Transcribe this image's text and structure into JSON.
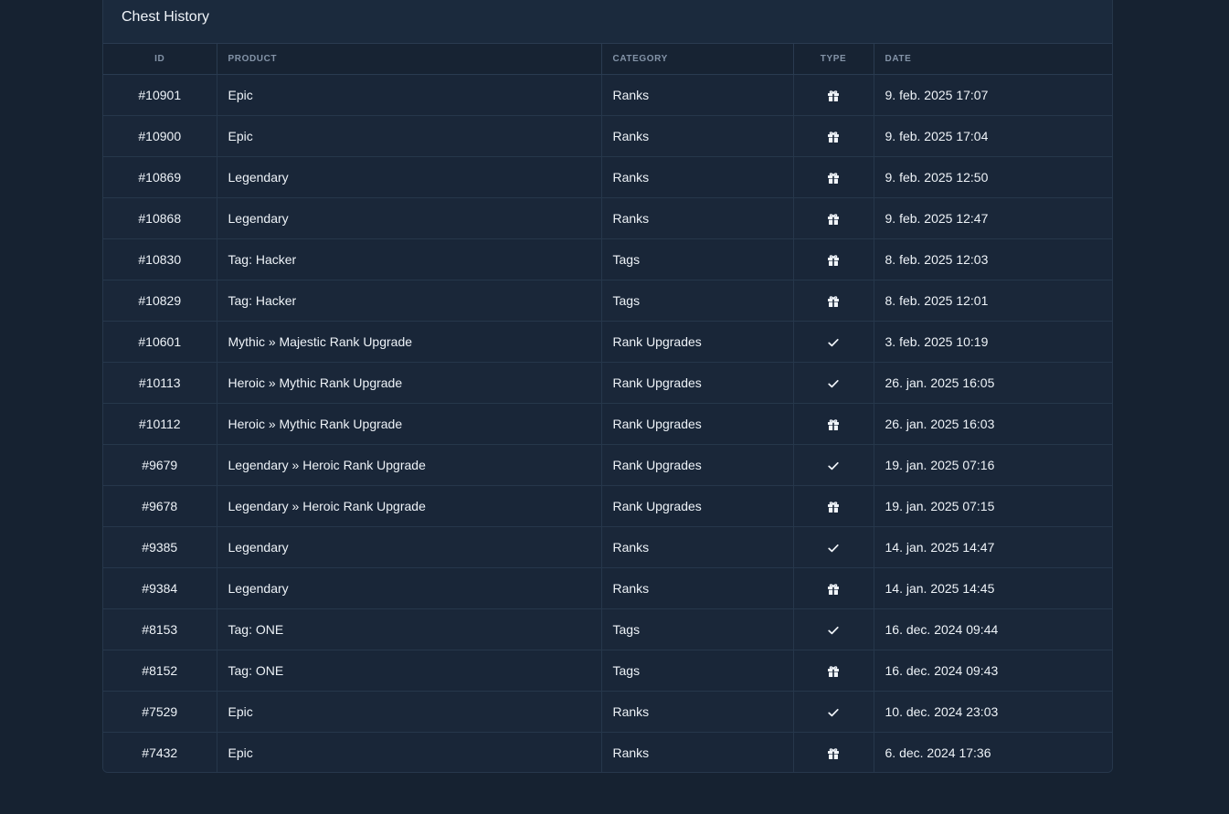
{
  "card": {
    "title": "Chest History"
  },
  "table": {
    "headers": {
      "id": "ID",
      "product": "PRODUCT",
      "category": "CATEGORY",
      "type": "TYPE",
      "date": "DATE"
    },
    "rows": [
      {
        "id": "#10901",
        "product": "Epic",
        "category": "Ranks",
        "type": "gift-icon",
        "date": "9. feb. 2025 17:07"
      },
      {
        "id": "#10900",
        "product": "Epic",
        "category": "Ranks",
        "type": "gift-icon",
        "date": "9. feb. 2025 17:04"
      },
      {
        "id": "#10869",
        "product": "Legendary",
        "category": "Ranks",
        "type": "gift-icon",
        "date": "9. feb. 2025 12:50"
      },
      {
        "id": "#10868",
        "product": "Legendary",
        "category": "Ranks",
        "type": "gift-icon",
        "date": "9. feb. 2025 12:47"
      },
      {
        "id": "#10830",
        "product": "Tag: Hacker",
        "category": "Tags",
        "type": "gift-icon",
        "date": "8. feb. 2025 12:03"
      },
      {
        "id": "#10829",
        "product": "Tag: Hacker",
        "category": "Tags",
        "type": "gift-icon",
        "date": "8. feb. 2025 12:01"
      },
      {
        "id": "#10601",
        "product": "Mythic » Majestic Rank Upgrade",
        "category": "Rank Upgrades",
        "type": "check-icon",
        "date": "3. feb. 2025 10:19"
      },
      {
        "id": "#10113",
        "product": "Heroic » Mythic Rank Upgrade",
        "category": "Rank Upgrades",
        "type": "check-icon",
        "date": "26. jan. 2025 16:05"
      },
      {
        "id": "#10112",
        "product": "Heroic » Mythic Rank Upgrade",
        "category": "Rank Upgrades",
        "type": "gift-icon",
        "date": "26. jan. 2025 16:03"
      },
      {
        "id": "#9679",
        "product": "Legendary » Heroic Rank Upgrade",
        "category": "Rank Upgrades",
        "type": "check-icon",
        "date": "19. jan. 2025 07:16"
      },
      {
        "id": "#9678",
        "product": "Legendary » Heroic Rank Upgrade",
        "category": "Rank Upgrades",
        "type": "gift-icon",
        "date": "19. jan. 2025 07:15"
      },
      {
        "id": "#9385",
        "product": "Legendary",
        "category": "Ranks",
        "type": "check-icon",
        "date": "14. jan. 2025 14:47"
      },
      {
        "id": "#9384",
        "product": "Legendary",
        "category": "Ranks",
        "type": "gift-icon",
        "date": "14. jan. 2025 14:45"
      },
      {
        "id": "#8153",
        "product": "Tag: ONE",
        "category": "Tags",
        "type": "check-icon",
        "date": "16. dec. 2024 09:44"
      },
      {
        "id": "#8152",
        "product": "Tag: ONE",
        "category": "Tags",
        "type": "gift-icon",
        "date": "16. dec. 2024 09:43"
      },
      {
        "id": "#7529",
        "product": "Epic",
        "category": "Ranks",
        "type": "check-icon",
        "date": "10. dec. 2024 23:03"
      },
      {
        "id": "#7432",
        "product": "Epic",
        "category": "Ranks",
        "type": "gift-icon",
        "date": "6. dec. 2024 17:36"
      }
    ]
  },
  "colors": {
    "background": "#162231",
    "card": "#192638",
    "header_text": "#8494a8"
  }
}
